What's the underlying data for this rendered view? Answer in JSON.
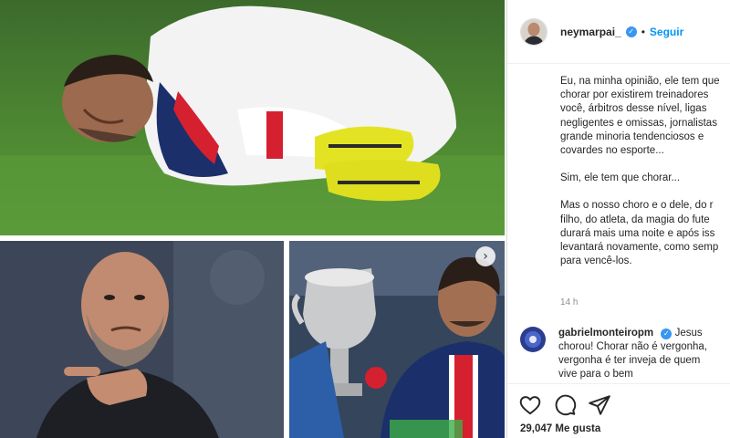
{
  "post": {
    "username": "neymarpai_",
    "follow_label": "Seguir",
    "separator": "•",
    "caption": [
      "Eu, na minha opinião, ele tem que",
      "chorar por existirem treinadores",
      "você, árbitros desse nível, ligas",
      "negligentes e omissas, jornalistas",
      "grande minoria tendenciosos e",
      "covardes no esporte...",
      "Sim, ele tem que chorar...",
      "Mas o nosso choro e o dele, do r",
      "filho, do atleta, da magia do fute",
      "durará mais uma noite e após iss",
      "levantará novamente, como semp",
      "para vencê-los."
    ],
    "time": "14 h",
    "likes": "29,047 Me gusta"
  },
  "comment": {
    "username": "gabrielmonteiropm",
    "lines": [
      "Jesus",
      "chorou! Chorar não é vergonha,",
      "vergonha é ter inveja de quem",
      "vive para o bem"
    ]
  },
  "icons": {
    "like": "heart-icon",
    "comment": "comment-icon",
    "share": "share-icon",
    "verified": "verified-badge-icon",
    "next": "chevron-right-icon"
  },
  "colors": {
    "accent": "#0095f6",
    "verified": "#3897f0",
    "text": "#262626",
    "muted": "#8e8e8e",
    "border": "#dbdbdb"
  }
}
